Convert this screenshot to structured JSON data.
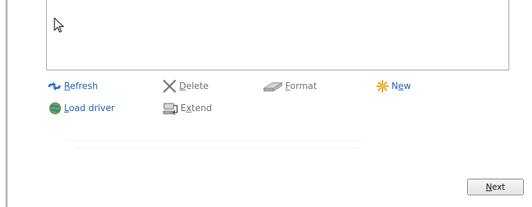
{
  "disk_actions": {
    "refresh": {
      "mnemonic": "R",
      "rest": "efresh",
      "icon": "refresh-icon"
    },
    "delete": {
      "mnemonic": "D",
      "rest": "elete",
      "icon": "delete-icon"
    },
    "format": {
      "mnemonic": "F",
      "rest": "ormat",
      "icon": "format-icon"
    },
    "new": {
      "prefix": "N",
      "mnemonic": "e",
      "rest": "w",
      "icon": "new-icon"
    },
    "load_driver": {
      "mnemonic": "L",
      "rest": "oad driver",
      "icon": "load-driver-icon"
    },
    "extend": {
      "prefix": "E",
      "mnemonic": "x",
      "rest": "tend",
      "icon": "extend-icon"
    }
  },
  "footer": {
    "next": {
      "mnemonic": "N",
      "rest": "ext"
    }
  },
  "colors": {
    "link": "#1f5fbf",
    "disabled": "#6d6d6d",
    "list_border": "#9d9d9d"
  }
}
